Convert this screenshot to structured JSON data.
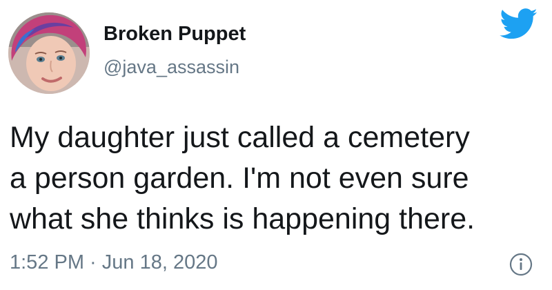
{
  "author": {
    "display_name": "Broken Puppet",
    "handle": "@java_assassin",
    "avatar_icon": "profile-photo",
    "verified": false
  },
  "brand": {
    "logo_icon": "twitter-bird-icon",
    "color": "#1da1f2"
  },
  "tweet": {
    "lines": [
      "My daughter just called a cemetery",
      "a person garden. I'm not even sure",
      "what she thinks is happening there."
    ],
    "timestamp": "1:52 PM · Jun 18, 2020"
  },
  "actions": {
    "info_icon": "info-icon"
  },
  "colors": {
    "text": "#14171a",
    "secondary_text": "#657786",
    "background": "#ffffff"
  }
}
